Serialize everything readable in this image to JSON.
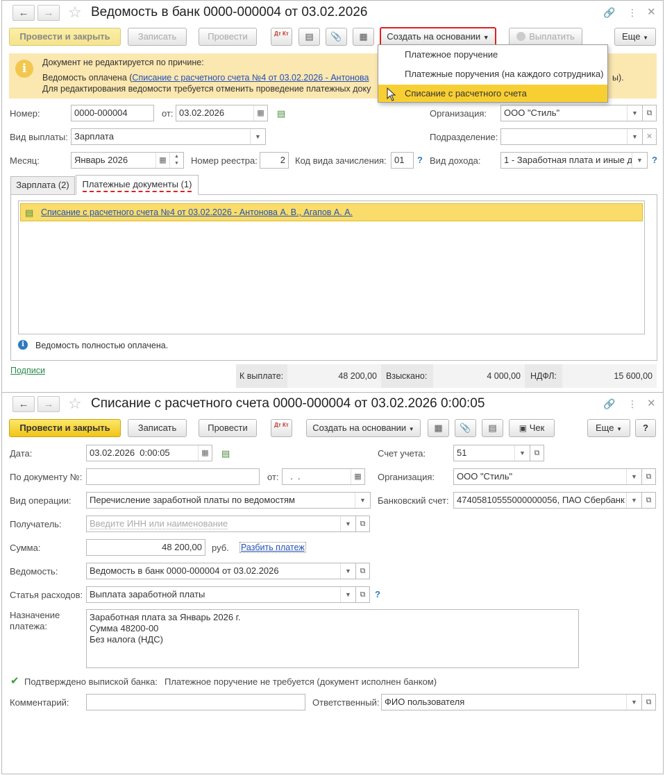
{
  "top": {
    "title": "Ведомость в банк 0000-000004 от 03.02.2026",
    "toolbar": {
      "post_close": "Провести и закрыть",
      "save": "Записать",
      "post": "Провести",
      "create_based": "Создать на основании",
      "pay": "Выплатить",
      "more": "Еще",
      "dtkt_icon": "Дт Кт"
    },
    "warning": {
      "line1": "Документ не редактируется по причине:",
      "line2_prefix": "Ведомость оплачена (",
      "line2_link": "Списание с расчетного счета №4 от 03.02.2026 - Антонова",
      "line2_tail": "ы).",
      "line3": "Для редактирования ведомости требуется отменить проведение платежных доку"
    },
    "menu": {
      "items": [
        "Платежное поручение",
        "Платежные поручения (на каждого сотрудника)",
        "Списание с расчетного счета"
      ]
    },
    "fields": {
      "number_label": "Номер:",
      "number_value": "0000-000004",
      "date_label": "от:",
      "date_value": "03.02.2026",
      "org_label": "Организация:",
      "org_value": "ООО \"Стиль\"",
      "pay_kind_label": "Вид выплаты:",
      "pay_kind_value": "Зарплата",
      "dept_label": "Подразделение:",
      "dept_value": "",
      "month_label": "Месяц:",
      "month_value": "Январь 2026",
      "registry_label": "Номер реестра:",
      "registry_value": "2",
      "code_label": "Код вида зачисления:",
      "code_value": "01",
      "income_label": "Вид дохода:",
      "income_value": "1 - Заработная плата и иные д"
    },
    "tabs": [
      "Зарплата (2)",
      "Платежные документы (1)"
    ],
    "row_link": "Списание с расчетного счета №4 от 03.02.2026 - Антонова А. В., Агапов А. А.",
    "info": "Ведомость полностью оплачена.",
    "signatures": "Подписи",
    "totals": {
      "to_pay_label": "К выплате:",
      "to_pay_value": "48 200,00",
      "withheld_label": "Взыскано:",
      "withheld_value": "4 000,00",
      "ndfl_label": "НДФЛ:",
      "ndfl_value": "15 600,00"
    }
  },
  "bottom": {
    "title": "Списание с расчетного счета 0000-000004 от 03.02.2026 0:00:05",
    "toolbar": {
      "post_close": "Провести и закрыть",
      "save": "Записать",
      "post": "Провести",
      "create_based": "Создать на основании",
      "check": "Чек",
      "more": "Еще",
      "help": "?",
      "dtkt_icon": "Дт Кт"
    },
    "fields": {
      "date_label": "Дата:",
      "date_value": "03.02.2026  0:00:05",
      "account_label": "Счет учета:",
      "account_value": "51",
      "doc_num_label": "По документу №:",
      "doc_num_value": "",
      "from_label": "от:",
      "from_value": "  .  .",
      "org_label": "Организация:",
      "org_value": "ООО \"Стиль\"",
      "op_label": "Вид операции:",
      "op_value": "Перечисление заработной платы по ведомостям",
      "bank_label": "Банковский счет:",
      "bank_value": "47405810555000000056, ПАО Сбербанк",
      "recipient_label": "Получатель:",
      "recipient_placeholder": "Введите ИНН или наименование",
      "sum_label": "Сумма:",
      "sum_value": "48 200,00",
      "currency": "руб.",
      "split_link": "Разбить платеж",
      "statement_label": "Ведомость:",
      "statement_value": "Ведомость в банк 0000-000004 от 03.02.2026",
      "expense_label": "Статья расходов:",
      "expense_value": "Выплата заработной платы",
      "purpose_label_1": "Назначение",
      "purpose_label_2": "платежа:",
      "purpose_lines": [
        "Заработная плата за Январь 2026 г.",
        "Сумма 48200-00",
        "Без налога (НДС)"
      ],
      "confirmed_label": "Подтверждено выпиской банка:",
      "confirmed_note": "Платежное поручение не требуется (документ исполнен банком)",
      "comment_label": "Комментарий:",
      "comment_value": "",
      "responsible_label": "Ответственный:",
      "responsible_value": "ФИО пользователя"
    }
  },
  "colors": {
    "accent_yellow": "#f5cd2b",
    "warning_bg": "#fbe7b0",
    "highlight_row": "#f9dc6a",
    "link": "#2351b5",
    "red_outline": "#e02020"
  }
}
